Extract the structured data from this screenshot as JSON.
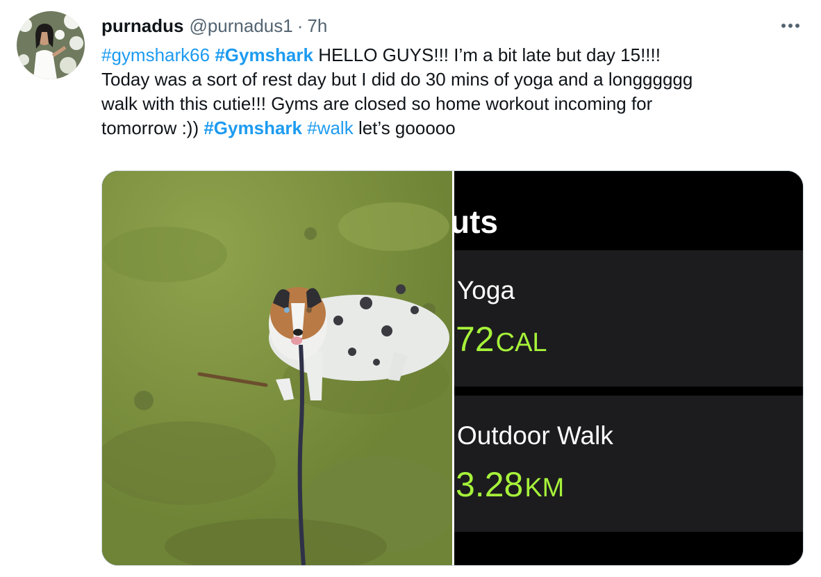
{
  "tweet": {
    "author_name": "purnadus",
    "handle": "@purnadus1",
    "separator": "·",
    "time": "7h",
    "text_lines": [
      [
        {
          "t": "#gymshark66",
          "k": "hashtag"
        },
        {
          "t": " ",
          "k": "plain"
        },
        {
          "t": "#Gymshark",
          "k": "hashtag-bold"
        },
        {
          "t": " HELLO GUYS!!! I’m a bit late but day 15!!!!",
          "k": "plain"
        }
      ],
      [
        {
          "t": "Today was a sort of rest day but I did do 30 mins of yoga and a longggggg",
          "k": "plain"
        }
      ],
      [
        {
          "t": "walk with this cutie!!! Gyms are closed so home workout incoming for",
          "k": "plain"
        }
      ],
      [
        {
          "t": "tomorrow :)) ",
          "k": "plain"
        },
        {
          "t": "#Gymshark",
          "k": "hashtag-bold"
        },
        {
          "t": " ",
          "k": "plain"
        },
        {
          "t": "#walk",
          "k": "hashtag"
        },
        {
          "t": " let’s gooooo",
          "k": "plain"
        }
      ]
    ]
  },
  "media": {
    "workout_screen": {
      "title_partial": "uts",
      "workouts": [
        {
          "name": "Yoga",
          "value": "72",
          "unit": "CAL"
        },
        {
          "name": "Outdoor Walk",
          "value": "3.28",
          "unit": "KM"
        }
      ]
    }
  },
  "colors": {
    "hashtag": "#1d9bf0",
    "secondary_text": "#536471",
    "workout_value": "#a6f23a",
    "card_bg": "#1c1c1e"
  },
  "icons": {
    "more": "more-horizontal-icon"
  }
}
